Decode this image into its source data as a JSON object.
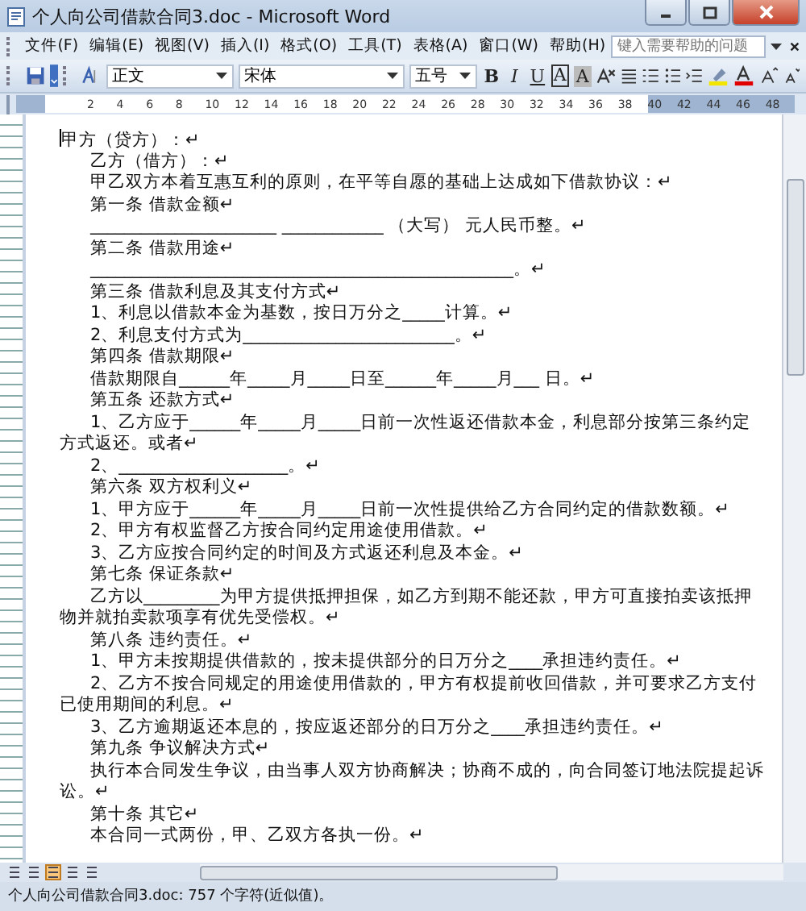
{
  "window": {
    "title": "个人向公司借款合同3.doc - Microsoft Word"
  },
  "menu": [
    "文件(F)",
    "编辑(E)",
    "视图(V)",
    "插入(I)",
    "格式(O)",
    "工具(T)",
    "表格(A)",
    "窗口(W)",
    "帮助(H)"
  ],
  "help_box": {
    "placeholder": "键入需要帮助的问题"
  },
  "toolbar": {
    "style": "正文",
    "font": "宋体",
    "size": "五号",
    "buttons": [
      {
        "kind": "bold",
        "label": "B"
      },
      {
        "kind": "italic",
        "label": "I"
      },
      {
        "kind": "underline",
        "label": "U"
      },
      {
        "kind": "border",
        "label": "A"
      },
      {
        "kind": "shade",
        "label": "A"
      }
    ]
  },
  "ruler": {
    "marks": [
      "2",
      "4",
      "6",
      "8",
      "10",
      "12",
      "14",
      "16",
      "18",
      "20",
      "22",
      "24",
      "26",
      "28",
      "30",
      "32",
      "34",
      "36",
      "38",
      "40",
      "42",
      "44",
      "46",
      "48"
    ]
  },
  "document": {
    "paragraphs": [
      {
        "indent": false,
        "lines": [
          "甲方（贷方）：↵"
        ]
      },
      {
        "indent": true,
        "lines": [
          "乙方（借方）：↵"
        ]
      },
      {
        "indent": true,
        "lines": [
          "甲乙双方本着互惠互利的原则，在平等自愿的基础上达成如下借款协议：↵"
        ]
      },
      {
        "indent": true,
        "lines": [
          "第一条  借款金额↵"
        ]
      },
      {
        "indent": true,
        "lines": [
          "______________________ ____________ （大写） 元人民币整。↵"
        ]
      },
      {
        "indent": true,
        "lines": [
          "第二条  借款用途↵"
        ]
      },
      {
        "indent": true,
        "lines": [
          "__________________________________________________。↵"
        ]
      },
      {
        "indent": true,
        "lines": [
          "第三条  借款利息及其支付方式↵"
        ]
      },
      {
        "indent": true,
        "lines": [
          "1、利息以借款本金为基数，按日万分之_____计算。↵"
        ]
      },
      {
        "indent": true,
        "lines": [
          "2、利息支付方式为_________________________。↵"
        ]
      },
      {
        "indent": true,
        "lines": [
          "第四条  借款期限↵"
        ]
      },
      {
        "indent": true,
        "lines": [
          "借款期限自______年_____月_____日至______年_____月___ 日。↵"
        ]
      },
      {
        "indent": true,
        "lines": [
          "第五条  还款方式↵"
        ]
      },
      {
        "indent": true,
        "lines": [
          "1、乙方应于______年_____月_____日前一次性返还借款本金，利息部分按第三条约定",
          "方式返还。或者↵"
        ]
      },
      {
        "indent": true,
        "lines": [
          "2、____________________。↵"
        ]
      },
      {
        "indent": true,
        "lines": [
          "第六条  双方权利义↵"
        ]
      },
      {
        "indent": true,
        "lines": [
          "1、甲方应于______年_____月_____日前一次性提供给乙方合同约定的借款数额。↵"
        ]
      },
      {
        "indent": true,
        "lines": [
          "2、甲方有权监督乙方按合同约定用途使用借款。↵"
        ]
      },
      {
        "indent": true,
        "lines": [
          "3、乙方应按合同约定的时间及方式返还利息及本金。↵"
        ]
      },
      {
        "indent": true,
        "lines": [
          "第七条  保证条款↵"
        ]
      },
      {
        "indent": true,
        "lines": [
          "乙方以_________为甲方提供抵押担保，如乙方到期不能还款，甲方可直接拍卖该抵押",
          "物并就拍卖款项享有优先受偿权。↵"
        ]
      },
      {
        "indent": true,
        "lines": [
          "第八条  违约责任。↵"
        ]
      },
      {
        "indent": true,
        "lines": [
          "1、甲方未按期提供借款的，按未提供部分的日万分之____承担违约责任。↵"
        ]
      },
      {
        "indent": true,
        "lines": [
          "2、乙方不按合同规定的用途使用借款的，甲方有权提前收回借款，并可要求乙方支付",
          "已使用期间的利息。↵"
        ]
      },
      {
        "indent": true,
        "lines": [
          "3、乙方逾期返还本息的，按应返还部分的日万分之____承担违约责任。↵"
        ]
      },
      {
        "indent": true,
        "lines": [
          "第九条  争议解决方式↵"
        ]
      },
      {
        "indent": true,
        "lines": [
          "执行本合同发生争议，由当事人双方协商解决；协商不成的，向合同签订地法院提起诉",
          "讼。↵"
        ]
      },
      {
        "indent": true,
        "lines": [
          "第十条  其它↵"
        ]
      },
      {
        "indent": true,
        "lines": [
          "本合同一式两份，甲、乙双方各执一份。↵"
        ]
      }
    ]
  },
  "view_buttons": [
    {
      "selected": false
    },
    {
      "selected": false
    },
    {
      "selected": true
    },
    {
      "selected": false
    },
    {
      "selected": false
    }
  ],
  "status_bar": "个人向公司借款合同3.doc: 757 个字符(近似值)。"
}
